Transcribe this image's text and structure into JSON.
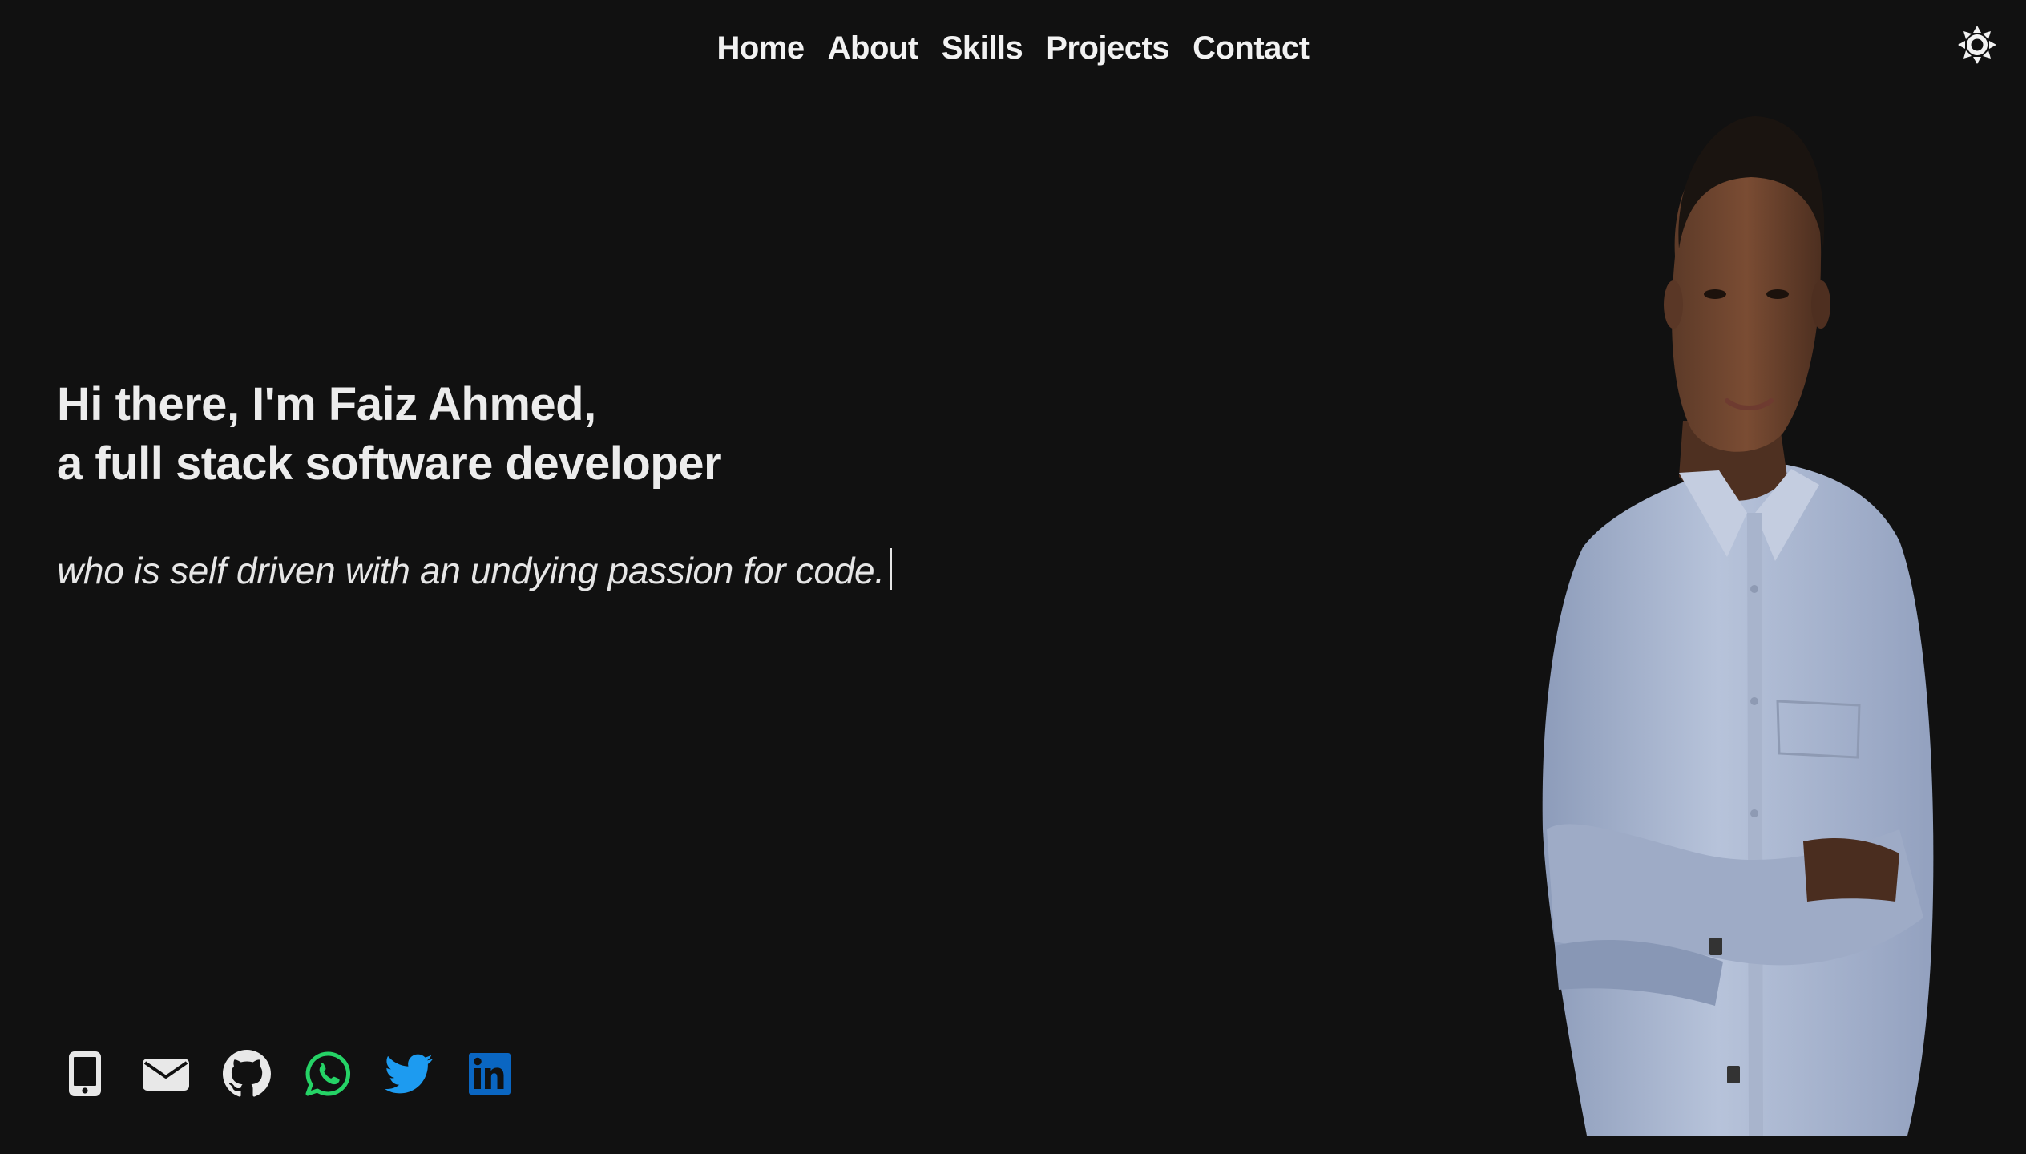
{
  "nav": {
    "items": [
      {
        "label": "Home"
      },
      {
        "label": "About"
      },
      {
        "label": "Skills"
      },
      {
        "label": "Projects"
      },
      {
        "label": "Contact"
      }
    ],
    "theme_toggle_icon": "sun-icon"
  },
  "hero": {
    "title_line1": "Hi there, I'm Faiz Ahmed,",
    "title_line2": "a full stack software developer",
    "tagline": "who is self driven with an undying passion for code."
  },
  "socials": [
    {
      "icon": "phone-icon",
      "color": "#e8e8e8"
    },
    {
      "icon": "email-icon",
      "color": "#e8e8e8"
    },
    {
      "icon": "github-icon",
      "color": "#e8e8e8"
    },
    {
      "icon": "whatsapp-icon",
      "color": "#25d366"
    },
    {
      "icon": "twitter-icon",
      "color": "#1d9bf0"
    },
    {
      "icon": "linkedin-icon",
      "color": "#0a66c2"
    }
  ],
  "portrait": {
    "icon": "profile-photo"
  },
  "colors": {
    "background": "#111111",
    "text": "#f0f0f0"
  }
}
